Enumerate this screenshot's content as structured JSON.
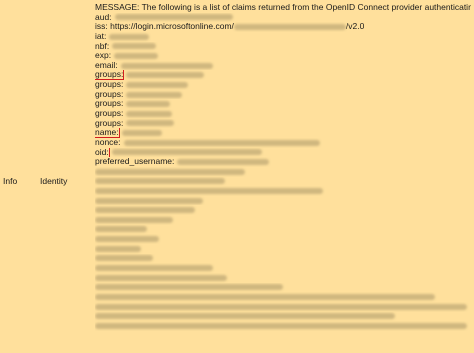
{
  "row": {
    "level": "Info",
    "category": "Identity"
  },
  "message": {
    "header": "MESSAGE: The following is a list of claims returned from the OpenID Connect provider authenticating with Azure",
    "claims": [
      {
        "key": "aud:",
        "value": "",
        "redacted": true,
        "boxed": false
      },
      {
        "key": "iss:",
        "value": "https://login.microsoftonline.com/",
        "redacted": true,
        "suffix": "/v2.0",
        "boxed": false
      },
      {
        "key": "iat:",
        "value": "",
        "redacted": true,
        "boxed": false
      },
      {
        "key": "nbf:",
        "value": "",
        "redacted": true,
        "boxed": false
      },
      {
        "key": "exp:",
        "value": "",
        "redacted": true,
        "boxed": false
      },
      {
        "key": "email:",
        "value": "",
        "redacted": true,
        "boxed": false
      },
      {
        "key": "groups:",
        "value": "",
        "redacted": true,
        "boxed": true
      },
      {
        "key": "groups:",
        "value": "",
        "redacted": true,
        "boxed": false
      },
      {
        "key": "groups:",
        "value": "",
        "redacted": true,
        "boxed": false
      },
      {
        "key": "groups:",
        "value": "",
        "redacted": true,
        "boxed": false
      },
      {
        "key": "groups:",
        "value": "",
        "redacted": true,
        "boxed": false
      },
      {
        "key": "groups:",
        "value": "",
        "redacted": true,
        "boxed": false
      },
      {
        "key": "name:",
        "value": "",
        "redacted": true,
        "boxed": true
      },
      {
        "key": "nonce:",
        "value": "",
        "redacted": true,
        "boxed": false
      },
      {
        "key": "oid:",
        "value": "",
        "redacted": true,
        "boxed": true
      },
      {
        "key": "preferred_username:",
        "value": "",
        "redacted": true,
        "boxed": false
      }
    ],
    "redacted_lines": 15
  },
  "colors": {
    "background": "#ffe09c",
    "highlight_box": "#d21e1e",
    "text": "#1a1a1a"
  }
}
